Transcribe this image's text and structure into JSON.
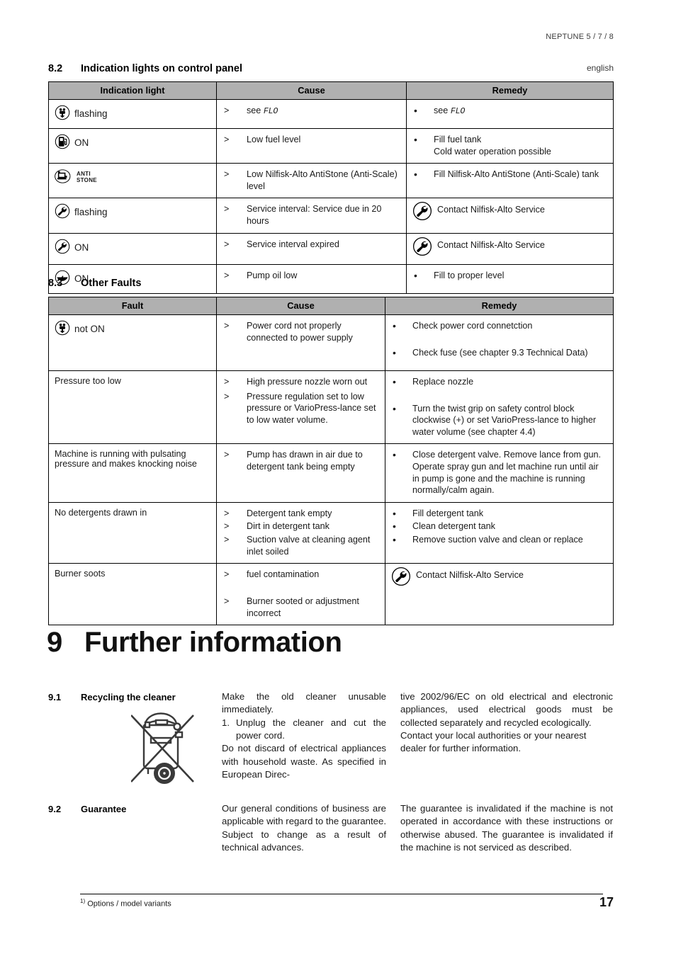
{
  "header": {
    "model": "NEPTUNE 5 / 7 / 8",
    "language": "english"
  },
  "section_82": {
    "number": "8.2",
    "title": "Indication lights on control panel",
    "columns": [
      "Indication light",
      "Cause",
      "Remedy"
    ],
    "rows": [
      {
        "icon": "plug-icon",
        "light_state": "flashing",
        "causes": [
          {
            "marker": ">",
            "text": "see ",
            "code": "FLO"
          }
        ],
        "remedies": [
          {
            "marker": "•",
            "text": "see ",
            "code": "FLO"
          }
        ]
      },
      {
        "icon": "fuel-pump-icon",
        "light_state": "ON",
        "causes": [
          {
            "marker": ">",
            "text": "Low fuel level"
          }
        ],
        "remedies": [
          {
            "marker": "•",
            "text": "Fill fuel tank\nCold water operation possible"
          }
        ]
      },
      {
        "icon": "anti-stone-icon",
        "light_state": "",
        "causes": [
          {
            "marker": ">",
            "text": "Low Nilfisk-Alto AntiStone (Anti-Scale) level"
          }
        ],
        "remedies": [
          {
            "marker": "•",
            "text": "Fill Nilfisk-Alto AntiStone (Anti-Scale) tank"
          }
        ]
      },
      {
        "icon": "wrench-icon",
        "light_state": "flashing",
        "causes": [
          {
            "marker": ">",
            "text": "Service interval: Service due in 20 hours"
          }
        ],
        "remedies": [
          {
            "marker": "service-icon",
            "text": "Contact Nilfisk-Alto Service"
          }
        ]
      },
      {
        "icon": "wrench-icon",
        "light_state": "ON",
        "causes": [
          {
            "marker": ">",
            "text": "Service interval expired"
          }
        ],
        "remedies": [
          {
            "marker": "service-icon",
            "text": "Contact Nilfisk-Alto Service"
          }
        ]
      },
      {
        "icon": "oil-can-icon",
        "light_state": "ON",
        "causes": [
          {
            "marker": ">",
            "text": "Pump oil low"
          }
        ],
        "remedies": [
          {
            "marker": "•",
            "text": "Fill to proper level"
          }
        ]
      }
    ]
  },
  "section_83": {
    "number": "8.3",
    "title": "Other Faults",
    "columns": [
      "Fault",
      "Cause",
      "Remedy"
    ],
    "rows": [
      {
        "fault_icon": "plug-icon",
        "fault": "not ON",
        "causes": [
          {
            "marker": ">",
            "text": "Power cord not properly connected to power supply"
          }
        ],
        "remedies": [
          {
            "marker": "•",
            "text": "Check power cord connetction"
          },
          {
            "marker": "•",
            "text": "Check fuse (see chapter 9.3 Technical Data)"
          }
        ]
      },
      {
        "fault": "Pressure too low",
        "causes": [
          {
            "marker": ">",
            "text": "High pressure nozzle worn out"
          },
          {
            "marker": ">",
            "text": "Pressure regulation set to low pressure or VarioPress-lance set to low water volume."
          }
        ],
        "remedies": [
          {
            "marker": "•",
            "text": "Replace nozzle"
          },
          {
            "marker": "•",
            "text": "Turn the twist grip on safety control block clockwise (+) or set VarioPress-lance to higher water volume (see chapter 4.4)"
          }
        ]
      },
      {
        "fault": "Machine is running with pulsating pressure and makes knocking noise",
        "causes": [
          {
            "marker": ">",
            "text": "Pump has drawn in air due to detergent tank being empty"
          }
        ],
        "remedies": [
          {
            "marker": "•",
            "text": "Close detergent valve. Remove lance from gun. Operate spray gun and let machine run until air in pump is gone and the machine is running normally/calm again."
          }
        ]
      },
      {
        "fault": "No detergents drawn in",
        "causes": [
          {
            "marker": ">",
            "text": "Detergent tank empty"
          },
          {
            "marker": ">",
            "text": "Dirt in detergent tank"
          },
          {
            "marker": ">",
            "text": "Suction valve at cleaning agent inlet soiled"
          }
        ],
        "remedies": [
          {
            "marker": "•",
            "text": "Fill detergent tank"
          },
          {
            "marker": "•",
            "text": "Clean detergent tank"
          },
          {
            "marker": "•",
            "text": "Remove suction valve and clean or replace"
          }
        ]
      },
      {
        "fault": "Burner soots",
        "causes": [
          {
            "marker": ">",
            "text": "fuel contamination"
          },
          {
            "marker": ">",
            "text": "Burner sooted or adjustment incorrect"
          }
        ],
        "remedies": [
          {
            "marker": "service-icon",
            "text": "Contact Nilfisk-Alto Service"
          }
        ]
      }
    ]
  },
  "chapter9": {
    "number": "9",
    "title": "Further information",
    "recycling": {
      "number": "9.1",
      "heading": "Recycling the cleaner",
      "icon": "crossed-out-wheelie-bin-icon",
      "col1_intro": "Make the old cleaner unusable immediately.",
      "col1_list_number": "1.",
      "col1_list_item": "Unplug the cleaner and cut the power cord.",
      "col1_rest": "Do not discard of electrical appliances with household waste. As specified in European Direc-",
      "col2_para1": "tive 2002/96/EC on old electrical and electronic appliances, used electrical goods must be collected separately and recycled ecologically.",
      "col2_para2": "Contact your local authorities or your nearest dealer for further information."
    },
    "guarantee": {
      "number": "9.2",
      "heading": "Guarantee",
      "col1": "Our general conditions of business are applicable with regard to the guarantee. Subject to change as a result of technical advances.",
      "col2": "The guarantee is invalidated if the machine is not operated in accordance with these instructions or otherwise abused. The guarantee is invalidated if the machine is not serviced as described."
    }
  },
  "footer": {
    "note_marker": "1)",
    "note": "Options / model variants",
    "page_number": "17"
  }
}
